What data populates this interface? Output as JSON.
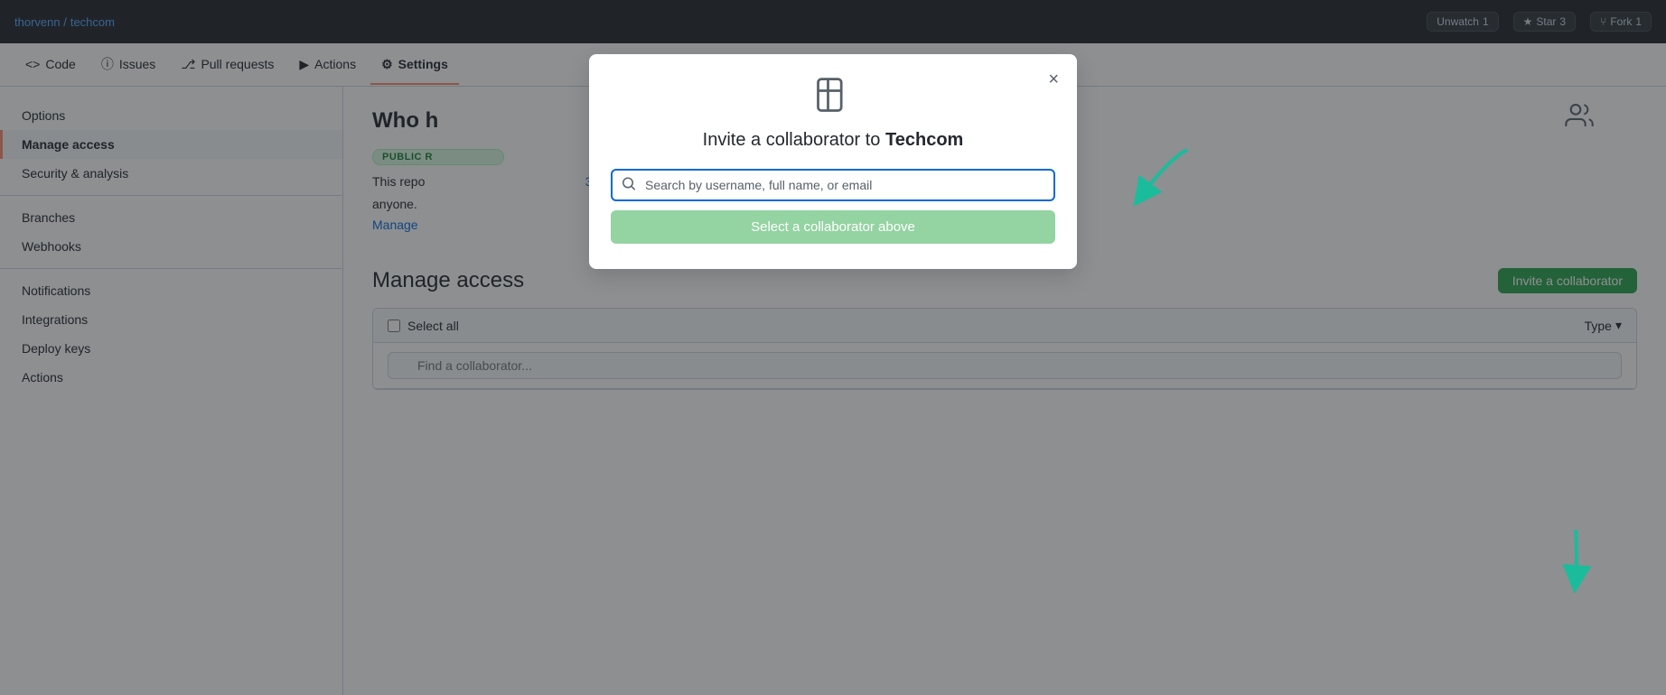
{
  "topnav": {
    "brand": "thorvenn / ",
    "brand_highlight": "techcom",
    "star_label": "Star",
    "star_count": "3",
    "fork_label": "Fork",
    "fork_count": "1",
    "unwatch_label": "Unwatch",
    "unwatch_count": "1"
  },
  "tabs": [
    {
      "id": "code",
      "label": "Code",
      "icon": "code"
    },
    {
      "id": "issues",
      "label": "Issues",
      "icon": "issue"
    },
    {
      "id": "pull-requests",
      "label": "Pull requests",
      "icon": "pr"
    },
    {
      "id": "actions",
      "label": "Actions",
      "icon": "actions"
    },
    {
      "id": "settings",
      "label": "Settings",
      "icon": "settings",
      "active": true
    }
  ],
  "sidebar": {
    "items": [
      {
        "id": "options",
        "label": "Options",
        "active": false
      },
      {
        "id": "manage-access",
        "label": "Manage access",
        "active": true
      },
      {
        "id": "security-analysis",
        "label": "Security & analysis",
        "active": false
      },
      {
        "id": "branches",
        "label": "Branches",
        "active": false
      },
      {
        "id": "webhooks",
        "label": "Webhooks",
        "active": false
      },
      {
        "id": "notifications",
        "label": "Notifications",
        "active": false
      },
      {
        "id": "integrations",
        "label": "Integrations",
        "active": false
      },
      {
        "id": "deploy-keys",
        "label": "Deploy keys",
        "active": false
      },
      {
        "id": "actions-sidebar",
        "label": "Actions",
        "active": false
      }
    ]
  },
  "main": {
    "who_has_access_title": "Who h",
    "public_repo_label": "PUBLIC R",
    "repo_description": "This repo",
    "repo_description2": "anyone.",
    "link_text": "3",
    "manage_link": "Manage",
    "manage_access_title": "Manage access",
    "invite_btn_label": "Invite a collaborator",
    "select_all_label": "Select all",
    "type_label": "Type",
    "find_placeholder": "Find a collaborator..."
  },
  "modal": {
    "title_prefix": "Invite a collaborator to ",
    "title_repo": "Techcom",
    "search_placeholder": "Search by username, full name, or email",
    "select_btn_label": "Select a collaborator above",
    "close_label": "×"
  }
}
